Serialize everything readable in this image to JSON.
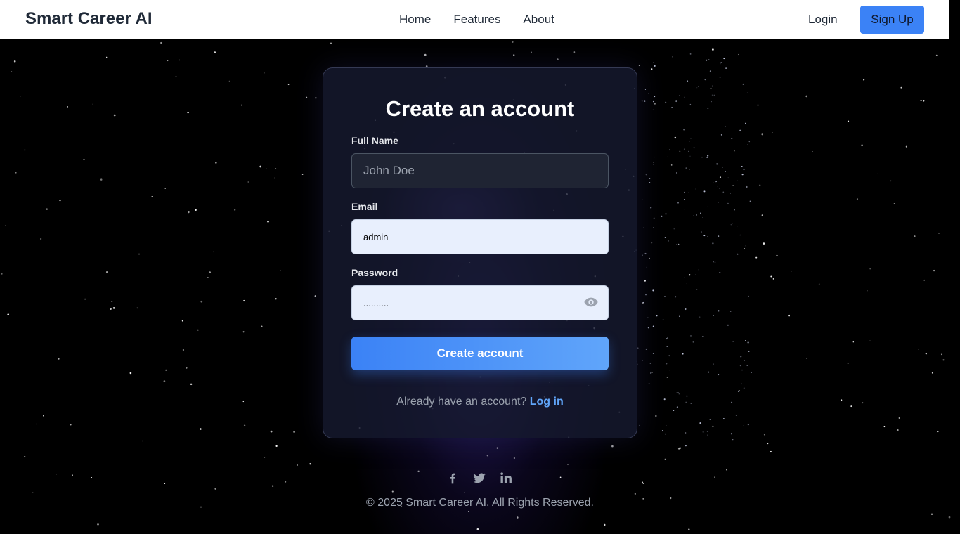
{
  "header": {
    "brand": "Smart Career AI",
    "nav": [
      "Home",
      "Features",
      "About"
    ],
    "login_label": "Login",
    "signup_label": "Sign Up"
  },
  "form": {
    "title": "Create an account",
    "full_name_label": "Full Name",
    "full_name_placeholder": "John Doe",
    "full_name_value": "",
    "email_label": "Email",
    "email_value": "admin",
    "password_label": "Password",
    "password_value": "..........",
    "submit_label": "Create account",
    "switch_prompt": "Already have an account?",
    "switch_link": "Log in"
  },
  "footer": {
    "socials": [
      "facebook-icon",
      "twitter-icon",
      "linkedin-icon"
    ],
    "copyright": "© 2025 Smart Career AI. All Rights Reserved."
  },
  "colors": {
    "accent": "#3b82f6",
    "link": "#60a5fa",
    "card_bg": "#161a30",
    "page_bg": "#000000"
  }
}
